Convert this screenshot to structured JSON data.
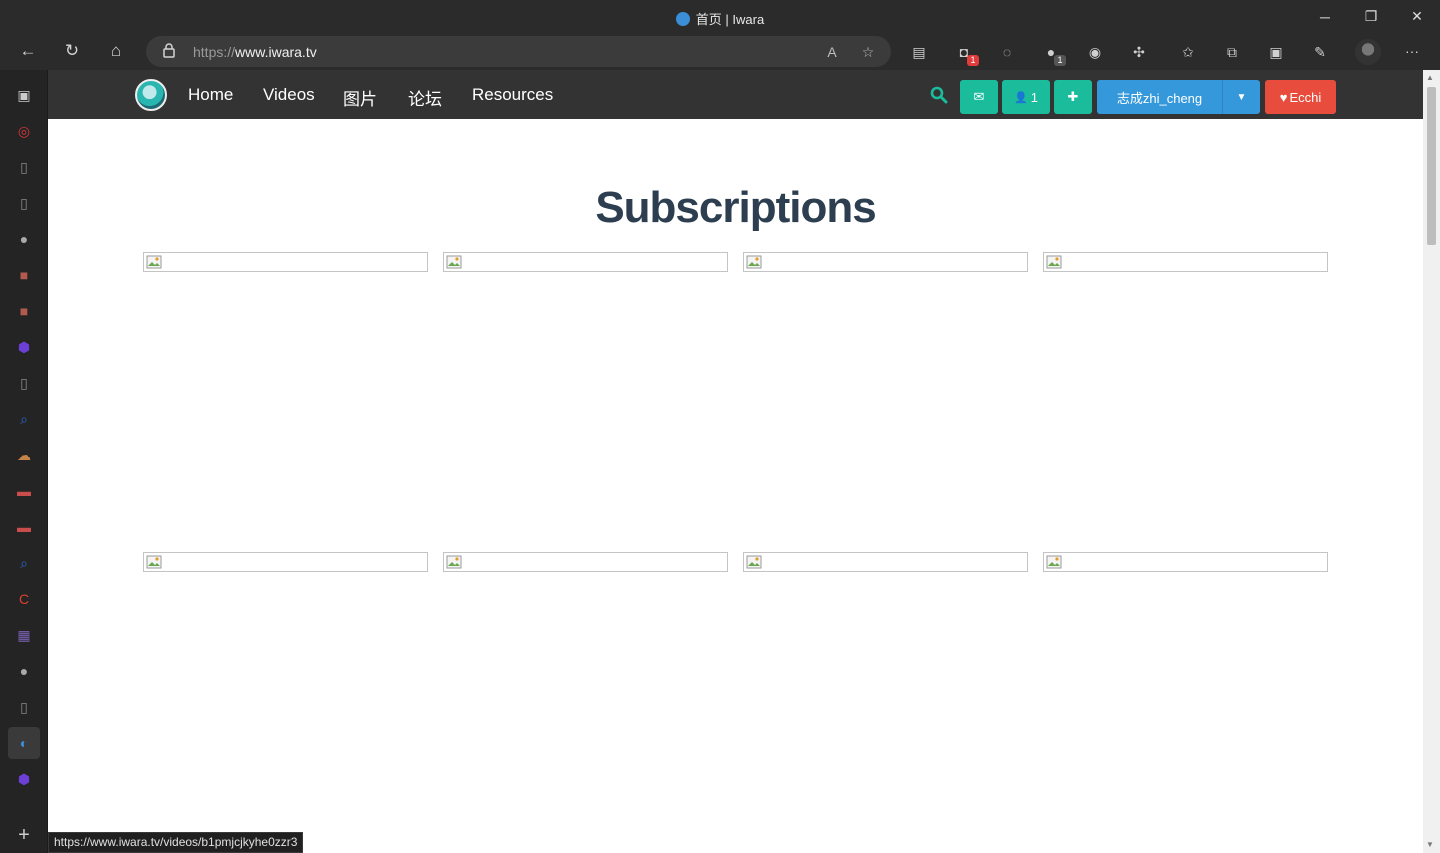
{
  "window": {
    "title": "首页 | Iwara",
    "minimize": "─",
    "restore": "❐",
    "close": "✕"
  },
  "toolbar": {
    "back": "←",
    "refresh": "↻",
    "home": "⌂",
    "url_prefix": "https://",
    "url_host": "www.iwara.tv",
    "read_aloud": "A",
    "add_favorite": "☆",
    "extensions": [
      {
        "name": "page-icon",
        "glyph": "▤",
        "badge": ""
      },
      {
        "name": "tab-icon",
        "glyph": "◘",
        "badge": "1",
        "badge_color": "#e23b3b"
      },
      {
        "name": "cat-icon",
        "glyph": "◌",
        "badge": ""
      },
      {
        "name": "red-extension-icon",
        "glyph": "●",
        "badge": "1",
        "badge_color": "#555555"
      },
      {
        "name": "owl-icon",
        "glyph": "◉",
        "badge": ""
      },
      {
        "name": "puzzle-icon",
        "glyph": "✣",
        "badge": ""
      },
      {
        "name": "favorites-icon",
        "glyph": "✩",
        "badge": ""
      },
      {
        "name": "collections-icon",
        "glyph": "⧉",
        "badge": ""
      },
      {
        "name": "screenshot-icon",
        "glyph": "▣",
        "badge": ""
      },
      {
        "name": "feedback-icon",
        "glyph": "✎",
        "badge": ""
      }
    ],
    "more": "···"
  },
  "sidebar": {
    "items": [
      {
        "name": "tab-actions-icon",
        "glyph": "▣",
        "color": "#cccccc"
      },
      {
        "name": "weibo-icon",
        "glyph": "◎",
        "color": "#d9383a"
      },
      {
        "name": "document-icon",
        "glyph": "▯",
        "color": "#888888"
      },
      {
        "name": "document-settings-icon",
        "glyph": "▯",
        "color": "#888888"
      },
      {
        "name": "github-icon",
        "glyph": "●",
        "color": "#aaaaaa"
      },
      {
        "name": "bookmark-red-icon",
        "glyph": "■",
        "color": "#b25a4e"
      },
      {
        "name": "bookmark-red-2-icon",
        "glyph": "■",
        "color": "#b25a4e"
      },
      {
        "name": "hexagon-icon",
        "glyph": "⬢",
        "color": "#6c3fd6"
      },
      {
        "name": "document-gear-icon",
        "glyph": "▯",
        "color": "#888888"
      },
      {
        "name": "search-small-icon",
        "glyph": "⌕",
        "color": "#2a6ad3"
      },
      {
        "name": "cloud-icon",
        "glyph": "☁",
        "color": "#c4834a"
      },
      {
        "name": "pdf-icon",
        "glyph": "▬",
        "color": "#c94d4d"
      },
      {
        "name": "pdf-2-icon",
        "glyph": "▬",
        "color": "#c94d4d"
      },
      {
        "name": "search-small-2-icon",
        "glyph": "⌕",
        "color": "#2a6ad3"
      },
      {
        "name": "c-app-icon",
        "glyph": "C",
        "color": "#d9432e"
      },
      {
        "name": "calendar-icon",
        "glyph": "▦",
        "color": "#7a62b5"
      },
      {
        "name": "github-2-icon",
        "glyph": "●",
        "color": "#aaaaaa"
      },
      {
        "name": "document-2-icon",
        "glyph": "▯",
        "color": "#888888"
      },
      {
        "name": "iwara-tab-icon",
        "glyph": "◐",
        "color": "#3a8fd6"
      },
      {
        "name": "hexagon-2-icon",
        "glyph": "⬢",
        "color": "#6c3fd6"
      }
    ],
    "add": "+"
  },
  "navbar": {
    "links": [
      "Home",
      "Videos",
      "图片",
      "论坛",
      "Resources"
    ],
    "message_glyph": "✉",
    "friends_glyph": "👤",
    "friends_count": "1",
    "add_glyph": "✚",
    "username": "志成zhi_cheng",
    "dropdown_glyph": "▼",
    "ecchi_glyph": "♥",
    "ecchi_label": "Ecchi"
  },
  "main": {
    "heading": "Subscriptions"
  },
  "status_url": "https://www.iwara.tv/videos/b1pmjcjkyhe0zzr3",
  "colors": {
    "teal": "#1abc9c",
    "blue": "#3498db",
    "red": "#e74c3c",
    "heading": "#2c3e50",
    "navbar": "#333333"
  }
}
